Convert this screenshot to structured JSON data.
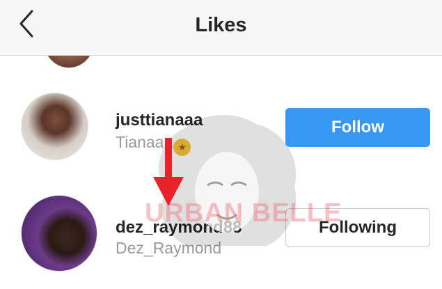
{
  "header": {
    "title": "Likes",
    "back_icon": "chevron-left-icon"
  },
  "likes": [
    {
      "username": "justtianaaa",
      "full_name": "Tianaaa",
      "emoji": "star-struck",
      "button": "Follow"
    },
    {
      "username": "dez_raymond88",
      "full_name": "Dez_Raymond",
      "button": "Following"
    }
  ],
  "watermark": {
    "text": "URBAN BELLE"
  },
  "colors": {
    "follow_button": "#3897f0",
    "arrow": "#e8232a",
    "secondary_text": "#9a9a9a"
  }
}
